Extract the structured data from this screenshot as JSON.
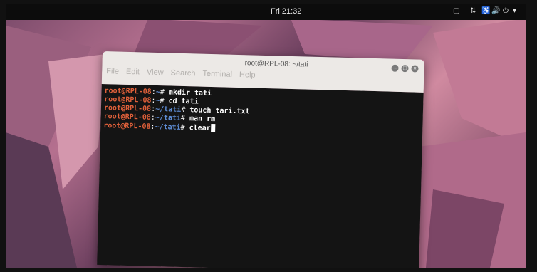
{
  "topbar": {
    "clock": "Fri 21:32",
    "tray_icons": [
      "workspace-icon",
      "network-icon",
      "accessibility-icon",
      "volume-icon",
      "power-icon",
      "menu-arrow-icon"
    ]
  },
  "window": {
    "title": "root@RPL-08: ~/tati",
    "menu": [
      "File",
      "Edit",
      "View",
      "Search",
      "Terminal",
      "Help"
    ]
  },
  "terminal": {
    "lines": [
      {
        "user": "root@RPL-08",
        "sep": ":",
        "path": "~",
        "prompt": "#",
        "cmd": " mkdir tati"
      },
      {
        "user": "root@RPL-08",
        "sep": ":",
        "path": "~",
        "prompt": "#",
        "cmd": " cd tati"
      },
      {
        "user": "root@RPL-08",
        "sep": ":",
        "path": "~/tati",
        "prompt": "#",
        "cmd": " touch tari.txt"
      },
      {
        "user": "root@RPL-08",
        "sep": ":",
        "path": "~/tati",
        "prompt": "#",
        "cmd": " man rm"
      },
      {
        "user": "root@RPL-08",
        "sep": ":",
        "path": "~/tati",
        "prompt": "#",
        "cmd": " clear"
      }
    ]
  },
  "colors": {
    "user": "#e0603a",
    "path": "#5f8ed6",
    "terminal_bg": "#141414"
  }
}
